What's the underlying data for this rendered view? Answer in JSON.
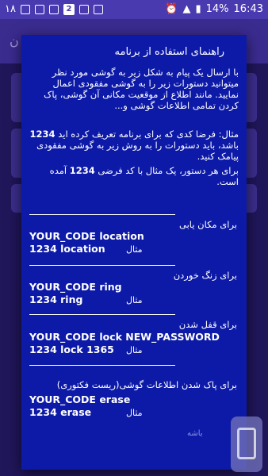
{
  "statusbar": {
    "time": "16:43",
    "battery": "14%",
    "notification_count": "2",
    "left_number": "۱۸"
  },
  "appbar": {
    "title_fragment": "ن"
  },
  "dialog": {
    "title": "راهنمای استفاده از برنامه",
    "intro": "با ارسال یک پیام به شکل زیر به گوشی مورد نظر میتوانید دستورات زیر را به گوشی مفقودی اعمال نمایید. مانند اطلاع از موقعیت مکانی آن گوشی، پاک کردن تمامی اطلاعات گوشی و...",
    "example_pre": "مثال: فرضا کدی که برای برنامه تعریف کرده اید",
    "example_code": "1234",
    "example_mid": "باشد، باید دستورات را به روش زیر به گوشی مفقودی پیامک کنید.",
    "example_end_pre": "برای هر دستور، یک مثال با کد فرضی",
    "example_end_code": "1234",
    "example_end_post": "آمده است.",
    "sections": [
      {
        "label": "برای مکان یابی",
        "command": "YOUR_CODE location",
        "example": "1234 location",
        "example_label": "مثال"
      },
      {
        "label": "برای زنگ خوردن",
        "command": "YOUR_CODE ring",
        "example": "1234 ring",
        "example_label": "مثال"
      },
      {
        "label": "برای قفل شدن",
        "command": "YOUR_CODE lock NEW_PASSWORD",
        "example": "1234 lock 1365",
        "example_label": "مثال"
      },
      {
        "label": "برای پاک شدن اطلاعات گوشی(ریست فکتوری)",
        "command": "YOUR_CODE erase",
        "example": "1234 erase",
        "example_label": "مثال"
      }
    ],
    "dismiss": "باشه"
  }
}
